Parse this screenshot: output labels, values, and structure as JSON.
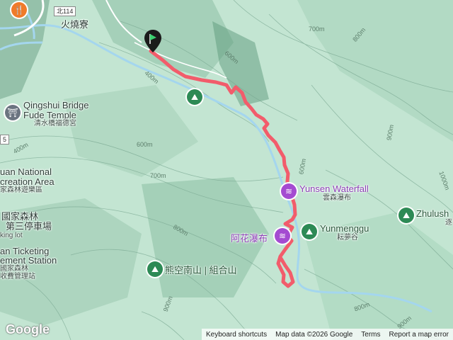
{
  "map": {
    "labels": {
      "huoshaoliao": "火燒寮",
      "qingshui_bridge": "Qingshui Bridge",
      "fude_temple": "Fude Temple",
      "qingshui_zh": "清水橋福德宮",
      "national_partial": "uan National",
      "recreation_area": "creation Area",
      "recreation_zh": "家森林遊樂區",
      "forest_partial": "國家森林",
      "parking_zh": "第三停車場",
      "parking_en": "king lot",
      "ticketing": "an Ticketing",
      "ticketing_zh": "國家森林",
      "station": "ement Station",
      "station_zh": "收費管理站",
      "yunsen_waterfall": "Yunsen Waterfall",
      "yunsen_zh": "雲森瀑布",
      "ahua_waterfall": "阿花瀑布",
      "yunmenggu": "Yunmenggu",
      "yunmenggu_zh": "耘夢谷",
      "xiongkong": "熊空南山 | 組合山",
      "zhulush": "Zhulush",
      "zhulush_zh": "逐",
      "road_shield": "北114",
      "side_shield": "5"
    },
    "contours": {
      "c700_top": "700m",
      "c800_top": "800m",
      "c600_a": "600m",
      "c400": "400m",
      "c400_left": "400m",
      "c600_mid": "600m",
      "c700_mid": "700m",
      "c600_right": "600m",
      "c900_right": "900m",
      "c1000": "1000m",
      "c800_bot": "800m",
      "c900_bot": "900m",
      "c800_br": "800m",
      "c900_br": "900m"
    },
    "icons": {
      "start": "start-flag-icon",
      "waterfall": "waterfall-icon",
      "hiking": "hiking-icon",
      "temple": "temple-icon",
      "food": "restaurant-icon"
    },
    "colors": {
      "track": "#f25c6b",
      "terrain": "#bfe3cf",
      "river": "#9fd3ea",
      "waterfall_pin": "#a44bd1",
      "park_pin": "#2d8a55"
    }
  },
  "footer": {
    "shortcuts": "Keyboard shortcuts",
    "map_data": "Map data ©2026 Google",
    "terms": "Terms",
    "report": "Report a map error"
  },
  "logo": "Google"
}
